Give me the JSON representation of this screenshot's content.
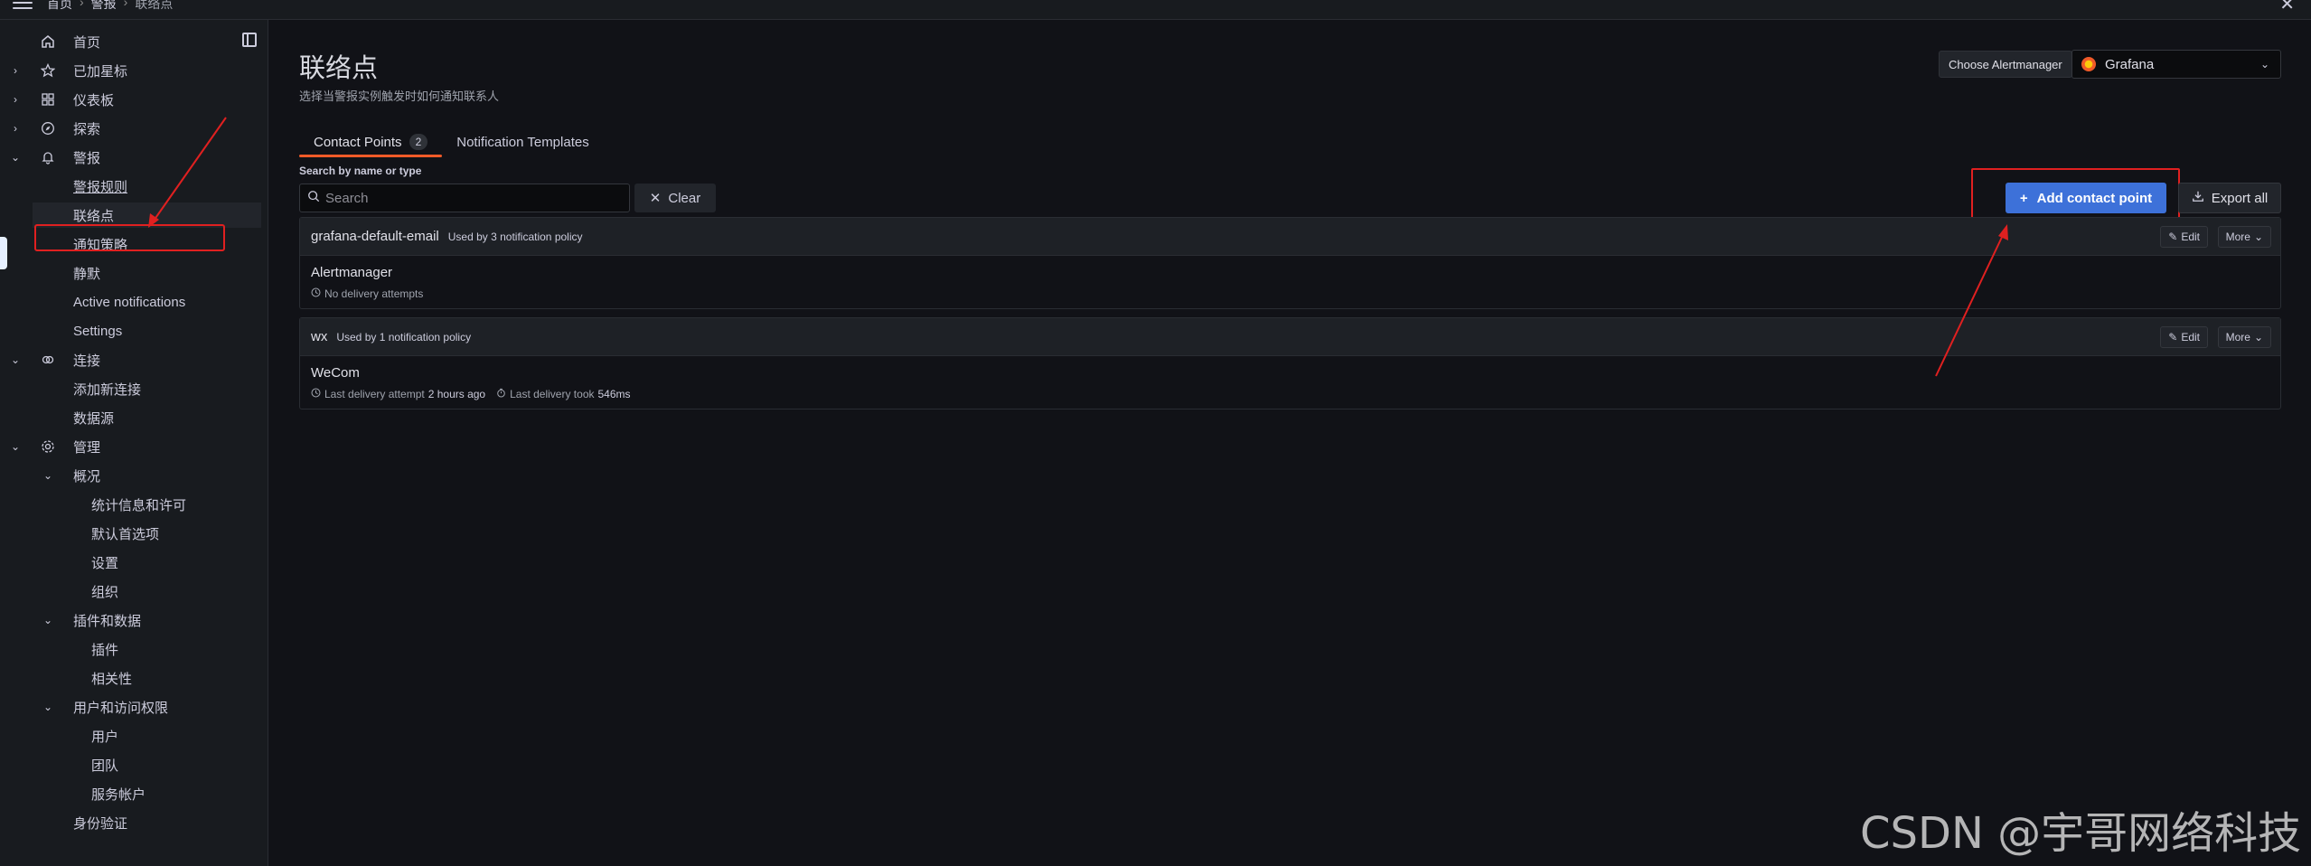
{
  "topbar": {
    "breadcrumb": [
      "首页",
      "警报",
      "联络点"
    ]
  },
  "sidebar": {
    "items": [
      {
        "label": "首页",
        "icon": "home-icon"
      },
      {
        "label": "已加星标",
        "icon": "star-icon"
      },
      {
        "label": "仪表板",
        "icon": "grid-icon"
      },
      {
        "label": "探索",
        "icon": "compass-icon"
      },
      {
        "label": "警报",
        "icon": "bell-icon"
      },
      {
        "label": "警报规则"
      },
      {
        "label": "联络点"
      },
      {
        "label": "通知策略"
      },
      {
        "label": "静默"
      },
      {
        "label": "Active notifications"
      },
      {
        "label": "Settings"
      },
      {
        "label": "连接",
        "icon": "link-icon"
      },
      {
        "label": "添加新连接"
      },
      {
        "label": "数据源"
      },
      {
        "label": "管理",
        "icon": "gear-icon"
      },
      {
        "label": "概况"
      },
      {
        "label": "统计信息和许可"
      },
      {
        "label": "默认首选项"
      },
      {
        "label": "设置"
      },
      {
        "label": "组织"
      },
      {
        "label": "插件和数据"
      },
      {
        "label": "插件"
      },
      {
        "label": "相关性"
      },
      {
        "label": "用户和访问权限"
      },
      {
        "label": "用户"
      },
      {
        "label": "团队"
      },
      {
        "label": "服务帐户"
      },
      {
        "label": "身份验证"
      }
    ]
  },
  "main": {
    "title": "联络点",
    "subtitle": "选择当警报实例触发时如何通知联系人",
    "alertmanager_label": "Choose Alertmanager",
    "alertmanager_value": "Grafana",
    "tabs": [
      {
        "label": "Contact Points",
        "count": "2"
      },
      {
        "label": "Notification Templates"
      }
    ],
    "search": {
      "label": "Search by name or type",
      "placeholder": "Search",
      "clear_label": "Clear"
    },
    "add_label": "Add contact point",
    "export_label": "Export all",
    "contact_points": [
      {
        "name": "grafana-default-email",
        "used": "Used by 3 notification policy",
        "receiver": "Alertmanager",
        "meta1": "No delivery attempts",
        "edit": "Edit",
        "more": "More"
      },
      {
        "name": "wx",
        "used": "Used by 1 notification policy",
        "receiver": "WeCom",
        "meta1": "Last delivery attempt",
        "meta1_value": "2 hours ago",
        "meta2": "Last delivery took",
        "meta2_value": "546ms",
        "edit": "Edit",
        "more": "More"
      }
    ]
  },
  "watermark": "CSDN @宇哥网络科技",
  "colors": {
    "accent": "#3d71d9",
    "tab_underline": "#f05a28",
    "annotation": "#e02020"
  }
}
